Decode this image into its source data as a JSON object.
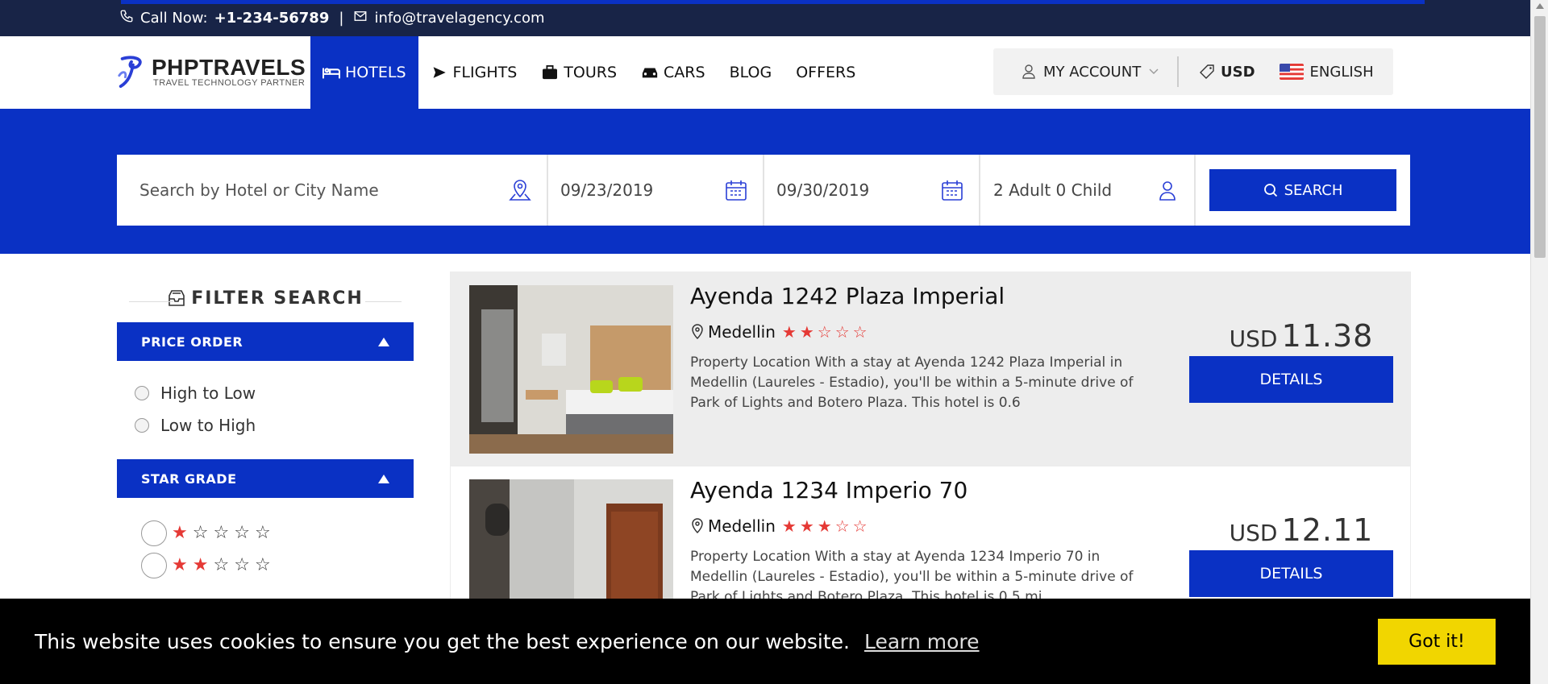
{
  "topbar": {
    "call_label": "Call Now:",
    "phone": "+1-234-56789",
    "separator": "|",
    "email": "info@travelagency.com"
  },
  "logo": {
    "brand": "PHPTRAVELS",
    "tagline": "TRAVEL TECHNOLOGY PARTNER"
  },
  "nav": {
    "hotels": "HOTELS",
    "flights": "FLIGHTS",
    "tours": "TOURS",
    "cars": "CARS",
    "blog": "BLOG",
    "offers": "OFFERS"
  },
  "account": {
    "label": "MY ACCOUNT",
    "currency": "USD",
    "language": "ENGLISH"
  },
  "search": {
    "placeholder": "Search by Hotel or City Name",
    "checkin": "09/23/2019",
    "checkout": "09/30/2019",
    "guests": "2 Adult 0 Child",
    "button": "SEARCH"
  },
  "sidebar": {
    "title": "FILTER SEARCH",
    "price_order": {
      "heading": "PRICE ORDER",
      "options": [
        "High to Low",
        "Low to High"
      ]
    },
    "star_grade": {
      "heading": "STAR GRADE",
      "visible_options": [
        1,
        2
      ]
    }
  },
  "results": [
    {
      "name": "Ayenda 1242 Plaza Imperial",
      "city": "Medellin",
      "stars": 2,
      "description": "Property Location With a stay at Ayenda 1242 Plaza Imperial in Medellin (Laureles - Estadio), you'll be within a 5-minute drive of Park of Lights and Botero Plaza. This hotel is 0.6",
      "currency": "USD",
      "price": "11.38",
      "button": "DETAILS"
    },
    {
      "name": "Ayenda 1234 Imperio 70",
      "city": "Medellin",
      "stars": 3,
      "description": "Property Location With a stay at Ayenda 1234 Imperio 70 in Medellin (Laureles - Estadio), you'll be within a 5-minute drive of Park of Lights and Botero Plaza. This hotel is 0.5 mi",
      "currency": "USD",
      "price": "12.11",
      "button": "DETAILS"
    }
  ],
  "cookie": {
    "message": "This website uses cookies to ensure you get the best experience on our website.",
    "learn_more": "Learn more",
    "accept": "Got it!"
  },
  "colors": {
    "brand_blue": "#0a31c4",
    "topbar": "#182447",
    "star": "#e53935",
    "cookie_button": "#f1d600"
  }
}
